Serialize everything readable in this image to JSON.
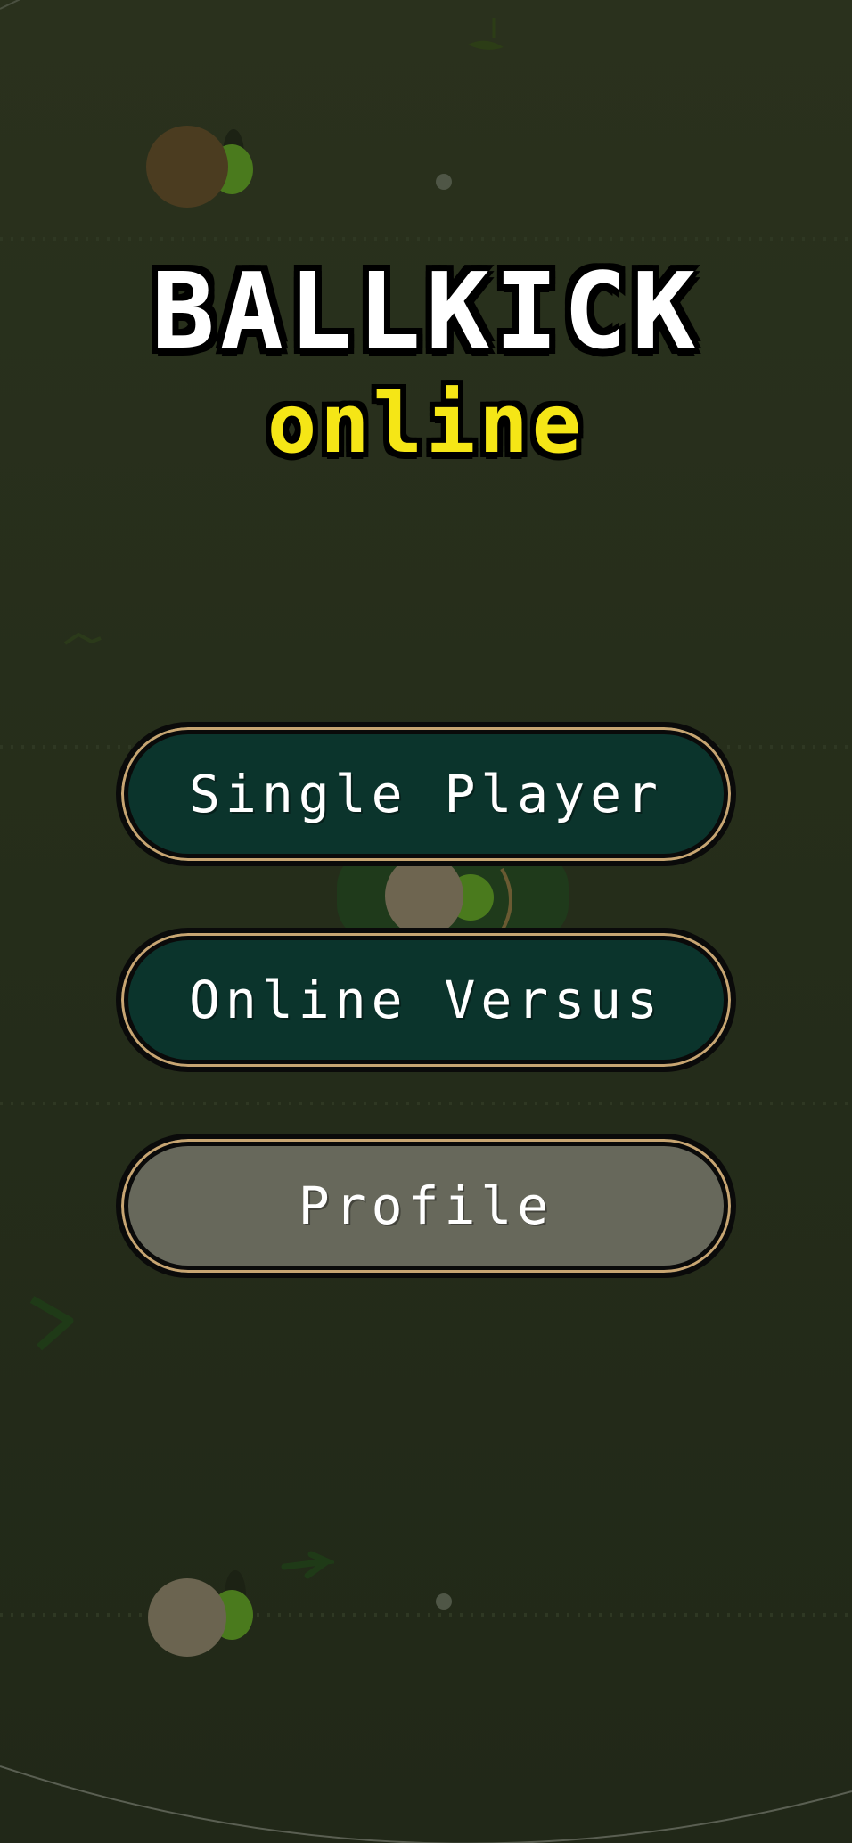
{
  "logo": {
    "title": "BALLKICK",
    "subtitle": "online"
  },
  "menu": {
    "single_player": "Single Player",
    "online_versus": "Online Versus",
    "profile": "Profile"
  },
  "colors": {
    "field": "#262e1b",
    "button_primary": "#0b342c",
    "button_disabled": "#67685b",
    "button_trim": "#c7a572",
    "logo_title": "#ffffff",
    "logo_subtitle": "#f5e616"
  },
  "icons": [
    "player-icon",
    "ball-icon",
    "grass-tuft-icon"
  ]
}
